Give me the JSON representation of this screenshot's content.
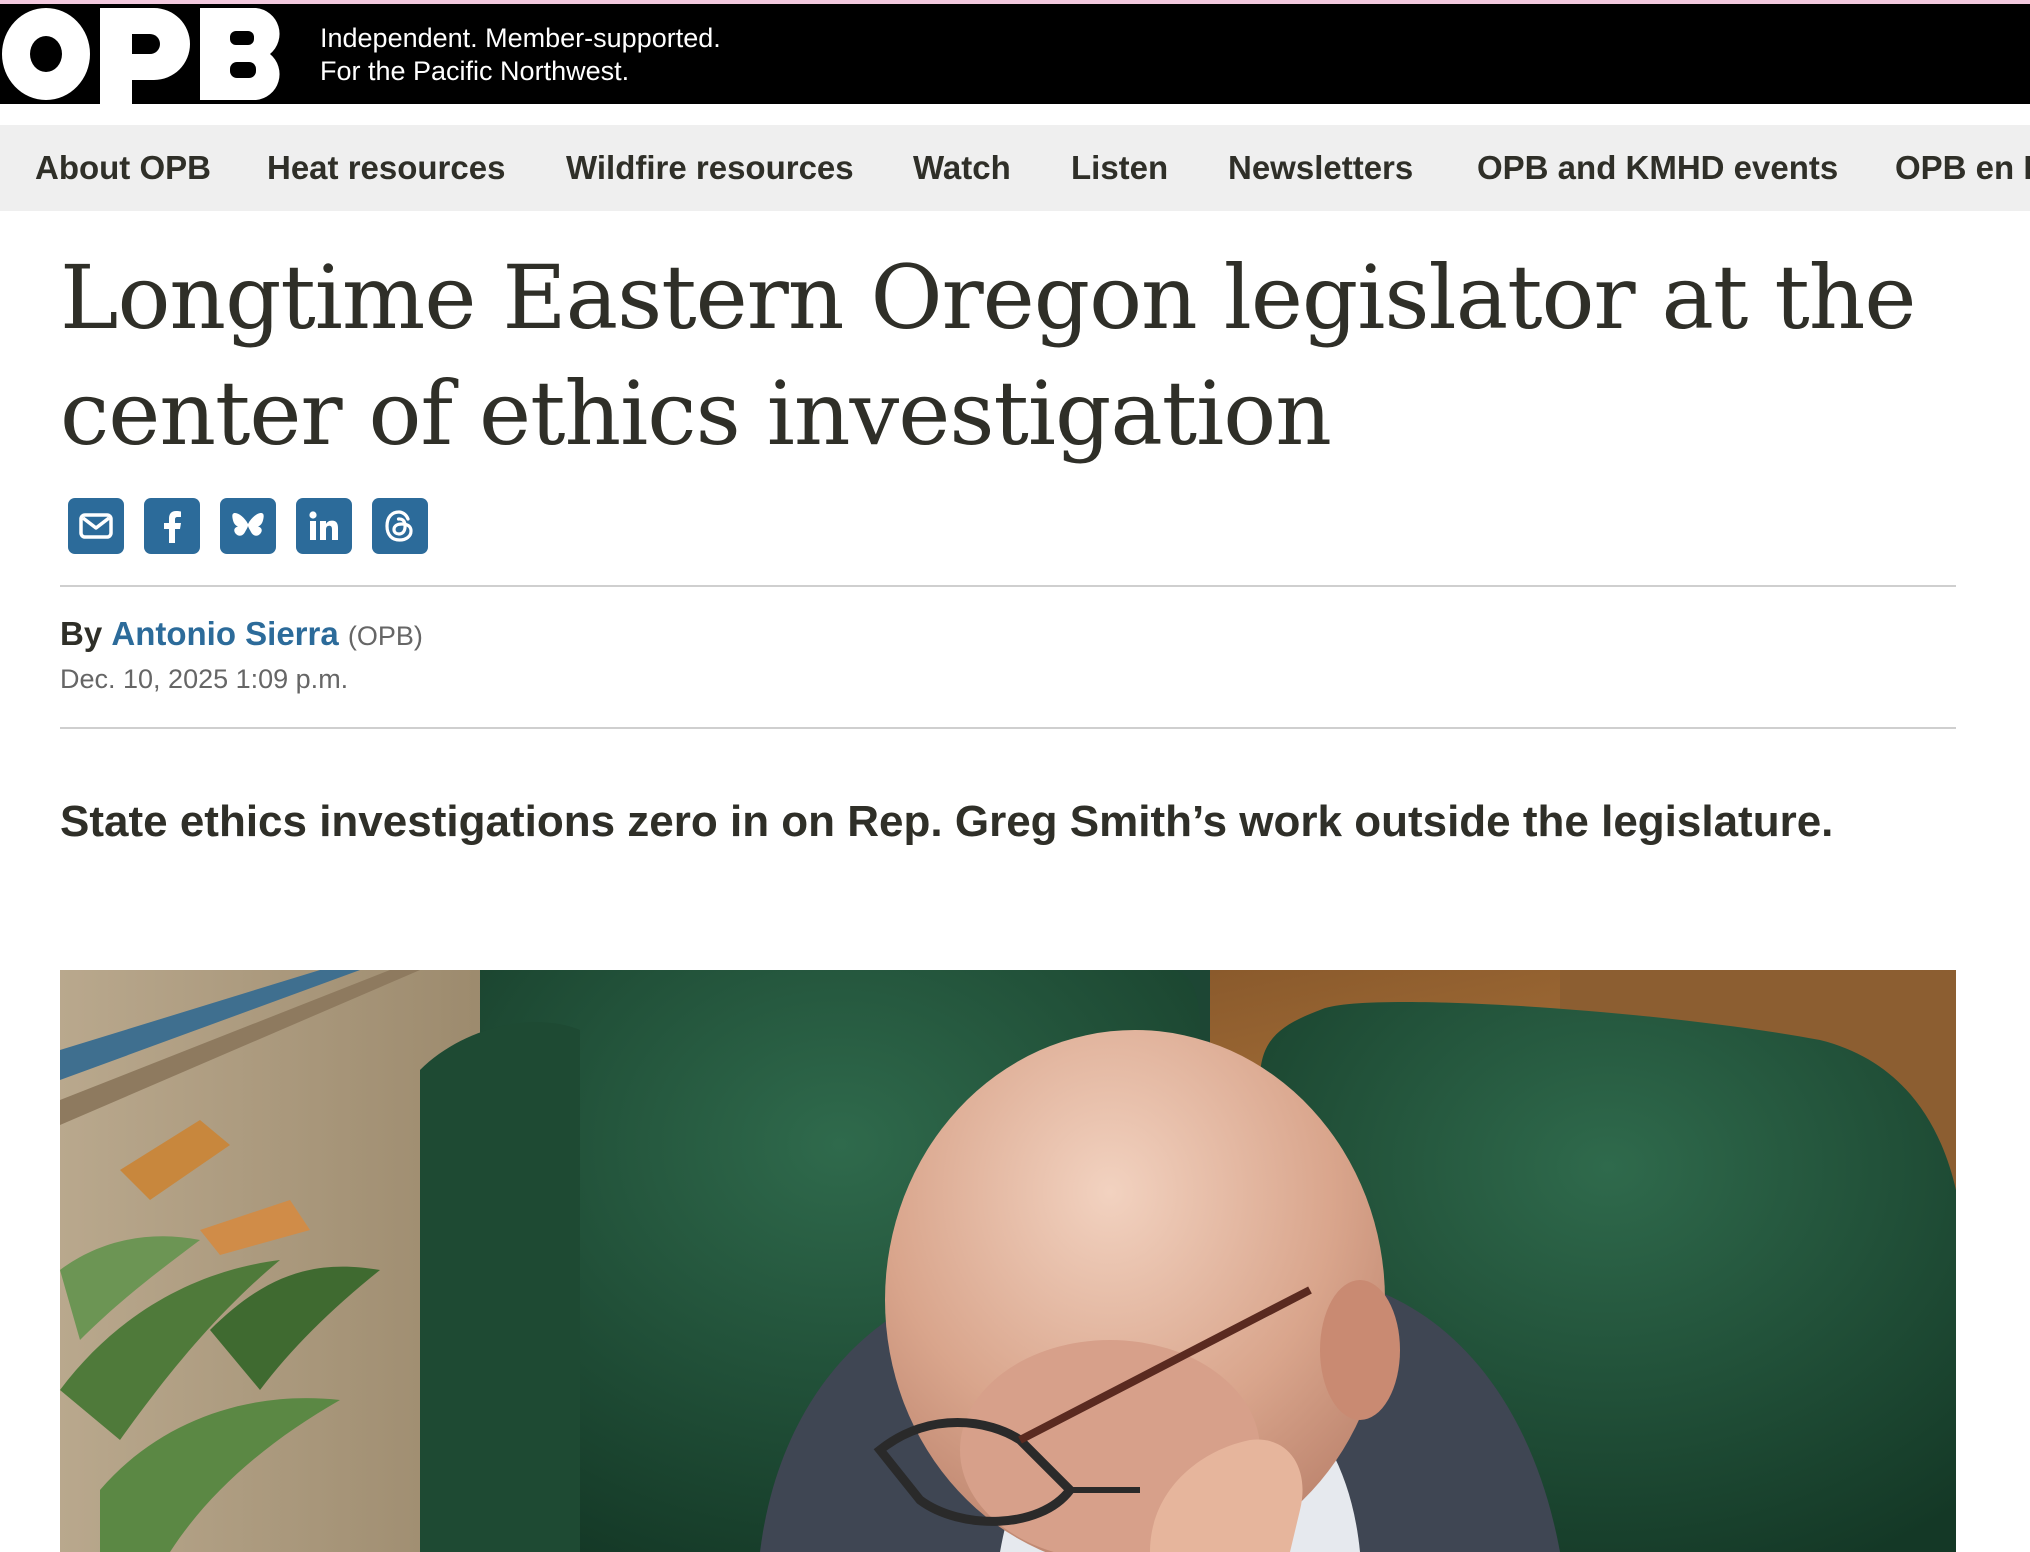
{
  "header": {
    "logo_text": "OPB",
    "tagline_line1": "Independent. Member-supported.",
    "tagline_line2": "For the Pacific Northwest."
  },
  "nav": {
    "items": [
      {
        "label": "About OPB"
      },
      {
        "label": "Heat resources"
      },
      {
        "label": "Wildfire resources"
      },
      {
        "label": "Watch"
      },
      {
        "label": "Listen"
      },
      {
        "label": "Newsletters"
      },
      {
        "label": "OPB and KMHD events"
      },
      {
        "label": "OPB en E"
      }
    ]
  },
  "article": {
    "headline": "Longtime Eastern Oregon legislator at the center of ethics investigation",
    "byline_prefix": "By",
    "author": "Antonio Sierra",
    "author_org": "(OPB)",
    "date": "Dec. 10, 2025 1:09 p.m.",
    "dek": "State ethics investigations zero in on Rep. Greg Smith’s work outside the legislature."
  },
  "share": {
    "icons": [
      "email-icon",
      "facebook-icon",
      "bluesky-icon",
      "linkedin-icon",
      "threads-icon"
    ]
  },
  "colors": {
    "header_bg": "#000000",
    "nav_bg": "#efefef",
    "accent_blue": "#2c6b9a",
    "text": "#2f2f28"
  }
}
